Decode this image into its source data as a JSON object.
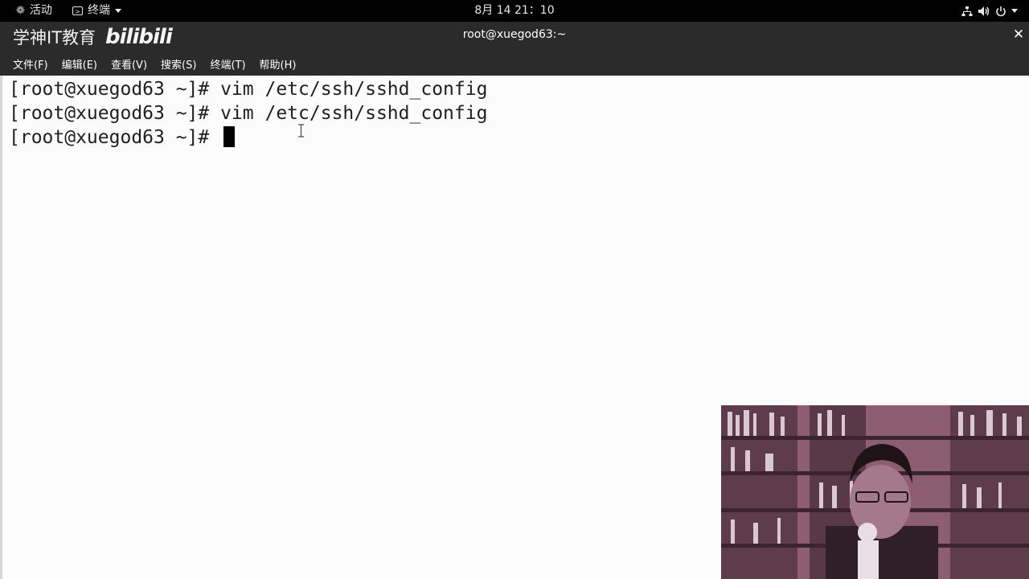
{
  "topbar": {
    "activities_label": "活动",
    "app_menu_label": "终端",
    "clock": "8月 14  21：10",
    "tray_icons": [
      "network-icon",
      "volume-icon",
      "power-icon"
    ]
  },
  "window": {
    "title": "root@xuegod63:~",
    "watermark_text": "学神IT教育",
    "watermark_logo": "bilibili"
  },
  "menubar": {
    "items": [
      "文件(F)",
      "编辑(E)",
      "查看(V)",
      "搜索(S)",
      "终端(T)",
      "帮助(H)"
    ]
  },
  "terminal": {
    "lines": [
      "[root@xuegod63 ~]# vim /etc/ssh/sshd_config",
      "[root@xuegod63 ~]# vim /etc/ssh/sshd_config",
      "[root@xuegod63 ~]# "
    ]
  },
  "colors": {
    "topbar_bg": "#000000",
    "titlebar_bg": "#2b2b2b",
    "terminal_bg": "#fcfcfc",
    "terminal_fg": "#202020"
  }
}
